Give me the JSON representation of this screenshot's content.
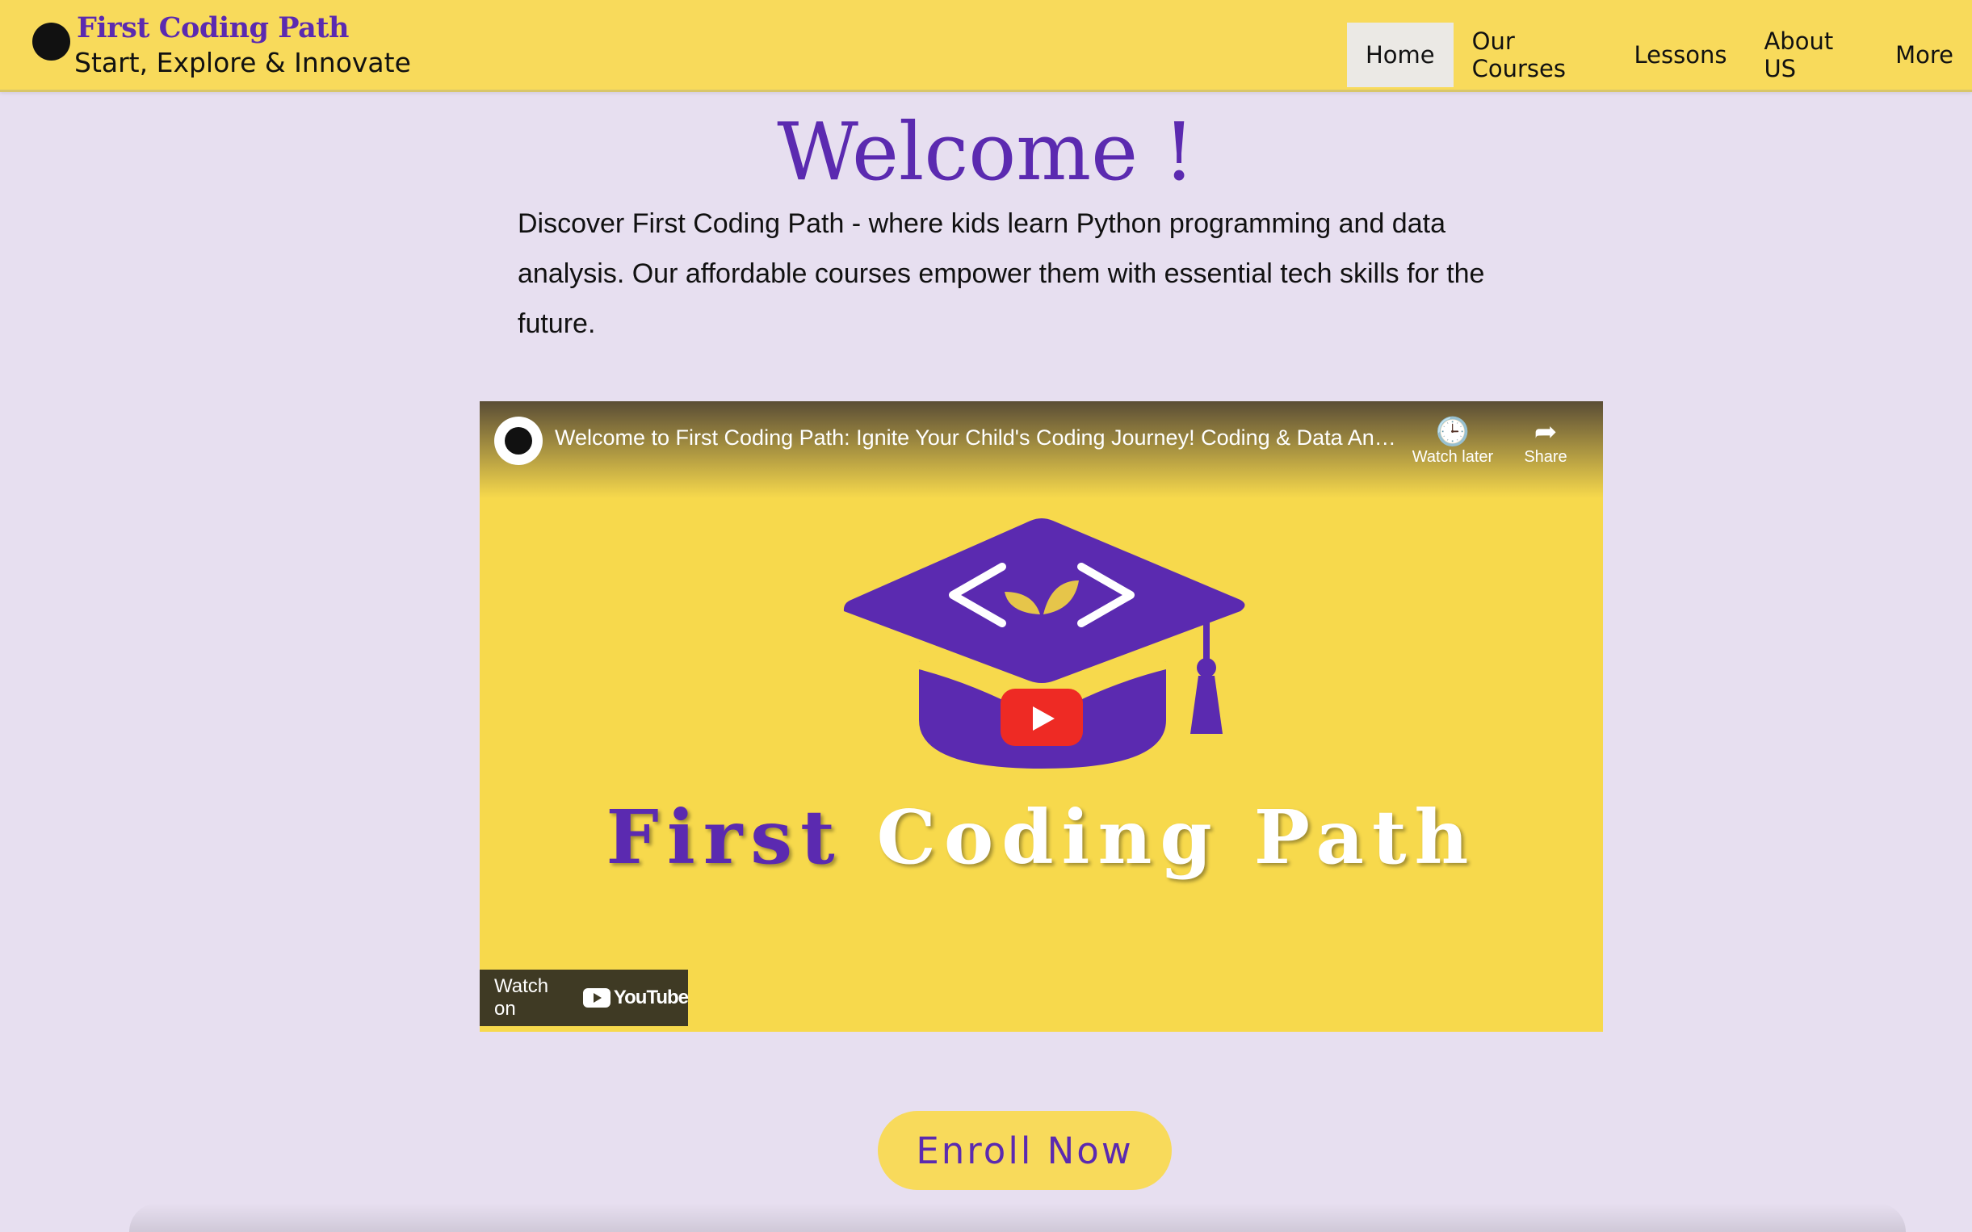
{
  "header": {
    "brand_name": "First Coding Path",
    "tagline": "Start, Explore & Innovate",
    "nav": [
      {
        "label": "Home",
        "active": true
      },
      {
        "label": "Our Courses",
        "active": false
      },
      {
        "label": "Lessons",
        "active": false
      },
      {
        "label": "About US",
        "active": false
      },
      {
        "label": "More",
        "active": false
      }
    ]
  },
  "hero": {
    "title": "Welcome !",
    "description": "Discover First Coding Path - where kids learn Python programming and data analysis. Our affordable courses empower them with essential tech skills for the future."
  },
  "video": {
    "title": "Welcome to First Coding Path: Ignite Your Child's Coding Journey! Coding & Data Anal...",
    "watch_later_label": "Watch later",
    "share_label": "Share",
    "thumbnail_first": "First",
    "thumbnail_rest": "Coding Path",
    "watch_on_label": "Watch on",
    "youtube_label": "YouTube"
  },
  "cta": {
    "enroll_label": "Enroll Now"
  },
  "colors": {
    "header_bg": "#f8da5b",
    "page_bg": "#e7dff0",
    "brand_purple": "#5b2ab0",
    "youtube_red": "#ee2a24"
  },
  "icons": [
    "logo-icon",
    "clock-icon",
    "share-icon",
    "play-icon",
    "youtube-logo-icon"
  ]
}
